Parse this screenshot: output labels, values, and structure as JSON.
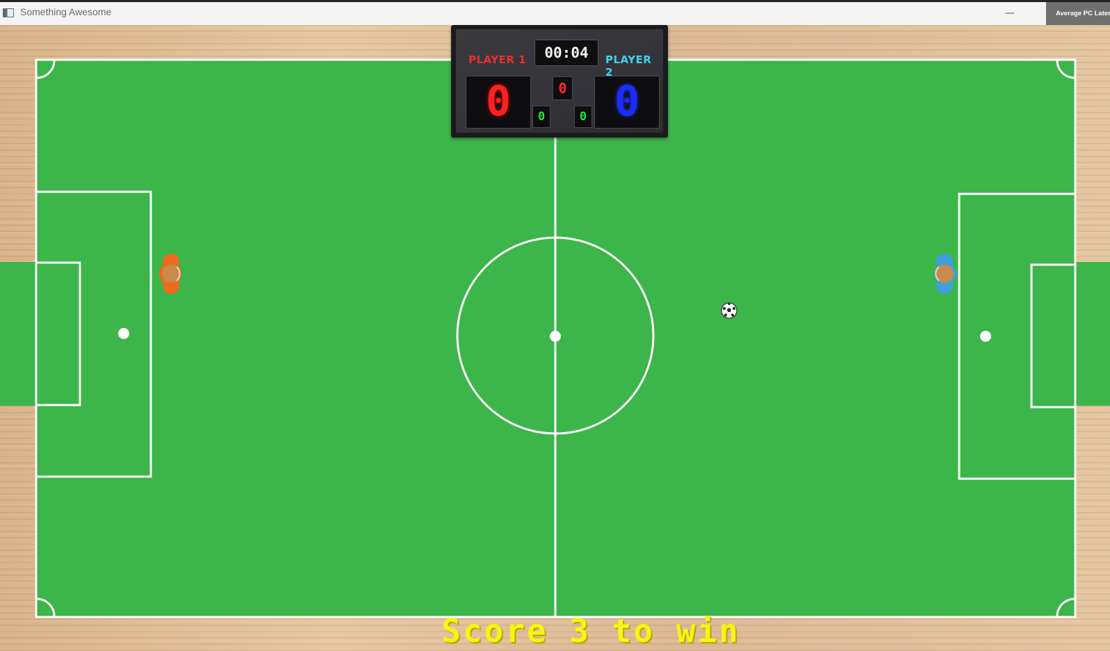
{
  "window": {
    "title": "Something Awesome",
    "minimize_glyph": "—",
    "latency_badge": "Average PC Laten"
  },
  "scoreboard": {
    "player1_label": "PLAYER 1",
    "player2_label": "PLAYER 2",
    "timer": "00:04",
    "player1_score": "0",
    "player2_score": "0",
    "center_red_digit": "0",
    "left_green_digit": "0",
    "right_green_digit": "0"
  },
  "players": {
    "player1_color": "#ee6a1e",
    "player2_color": "#3f9fdc",
    "head_color": "#c98a4b"
  },
  "pitch": {
    "grass_color": "#3cb54a",
    "line_color": "#ffffff"
  },
  "footer": {
    "message": "Score 3 to win"
  },
  "icons": {
    "app": "app-window-icon",
    "ball": "soccer-ball-icon"
  }
}
